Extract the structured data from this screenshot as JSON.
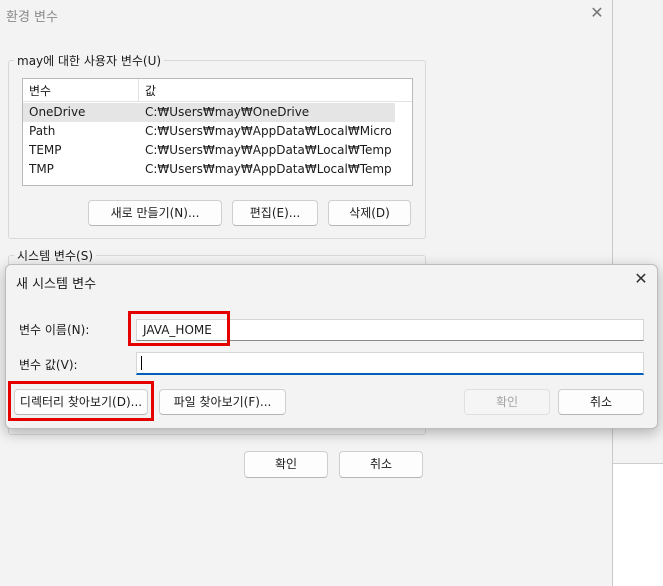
{
  "env_window": {
    "title": "환경 변수",
    "close_glyph": "✕",
    "user_group_label": "may에 대한 사용자 변수(U)",
    "list_columns": [
      "변수",
      "값"
    ],
    "user_vars": [
      {
        "name": "OneDrive",
        "value": "C:₩Users₩may₩OneDrive"
      },
      {
        "name": "Path",
        "value": "C:₩Users₩may₩AppData₩Local₩Microsoft..."
      },
      {
        "name": "TEMP",
        "value": "C:₩Users₩may₩AppData₩Local₩Temp"
      },
      {
        "name": "TMP",
        "value": "C:₩Users₩may₩AppData₩Local₩Temp"
      }
    ],
    "new_button": "새로 만들기(N)...",
    "edit_button": "편집(E)...",
    "delete_button": "삭제(D)",
    "system_group_label": "시스템 변수(S)",
    "ok_button": "확인",
    "cancel_button": "취소"
  },
  "dialog": {
    "title": "새 시스템 변수",
    "close_glyph": "✕",
    "name_label": "변수 이름(N):",
    "name_value": "JAVA_HOME",
    "value_label": "변수 값(V):",
    "value_value": "",
    "browse_dir_button": "디렉터리 찾아보기(D)...",
    "browse_file_button": "파일 찾아보기(F)...",
    "ok_button": "확인",
    "cancel_button": "취소"
  },
  "colors": {
    "highlight": "#e50000",
    "focus_accent": "#005fb8"
  }
}
